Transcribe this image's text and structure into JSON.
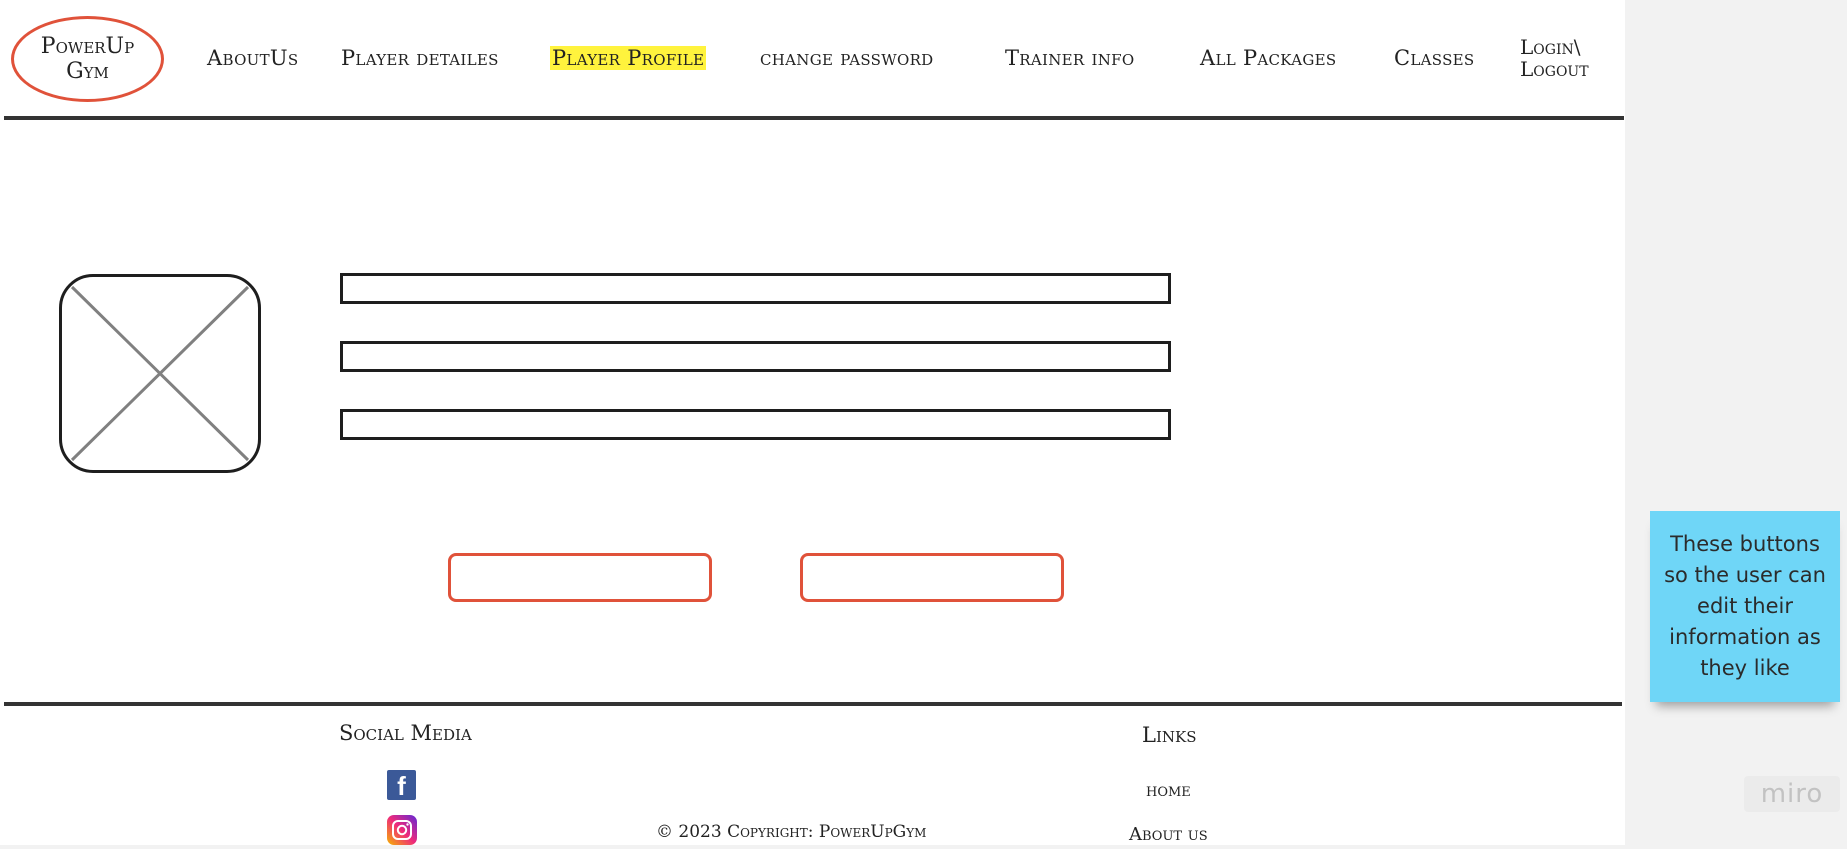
{
  "header": {
    "logo_text": "PowerUp\nGym",
    "nav": {
      "about": "AboutUs",
      "player_details": "Player detailes",
      "player_profile": "Player Profile",
      "change_password": "change password",
      "trainer_info": "Trainer info",
      "all_packages": "All Packages",
      "classes": "Classes",
      "login_logout": "Login\\\nLogout"
    },
    "active_item": "Player Profile"
  },
  "footer": {
    "social_heading": "Social Media",
    "links_heading": "Links",
    "links": {
      "home": "home",
      "about": "About us"
    },
    "copyright": "© 2023 Copyright: PowerUpGym",
    "icons": [
      "facebook-icon",
      "instagram-icon"
    ]
  },
  "sticky_note": {
    "text": "These buttons so the user can edit their information as they like"
  },
  "watermark": "miro",
  "colors": {
    "accent": "#e0523a",
    "highlight": "#fff33d",
    "sticky": "#6fd6f7"
  }
}
